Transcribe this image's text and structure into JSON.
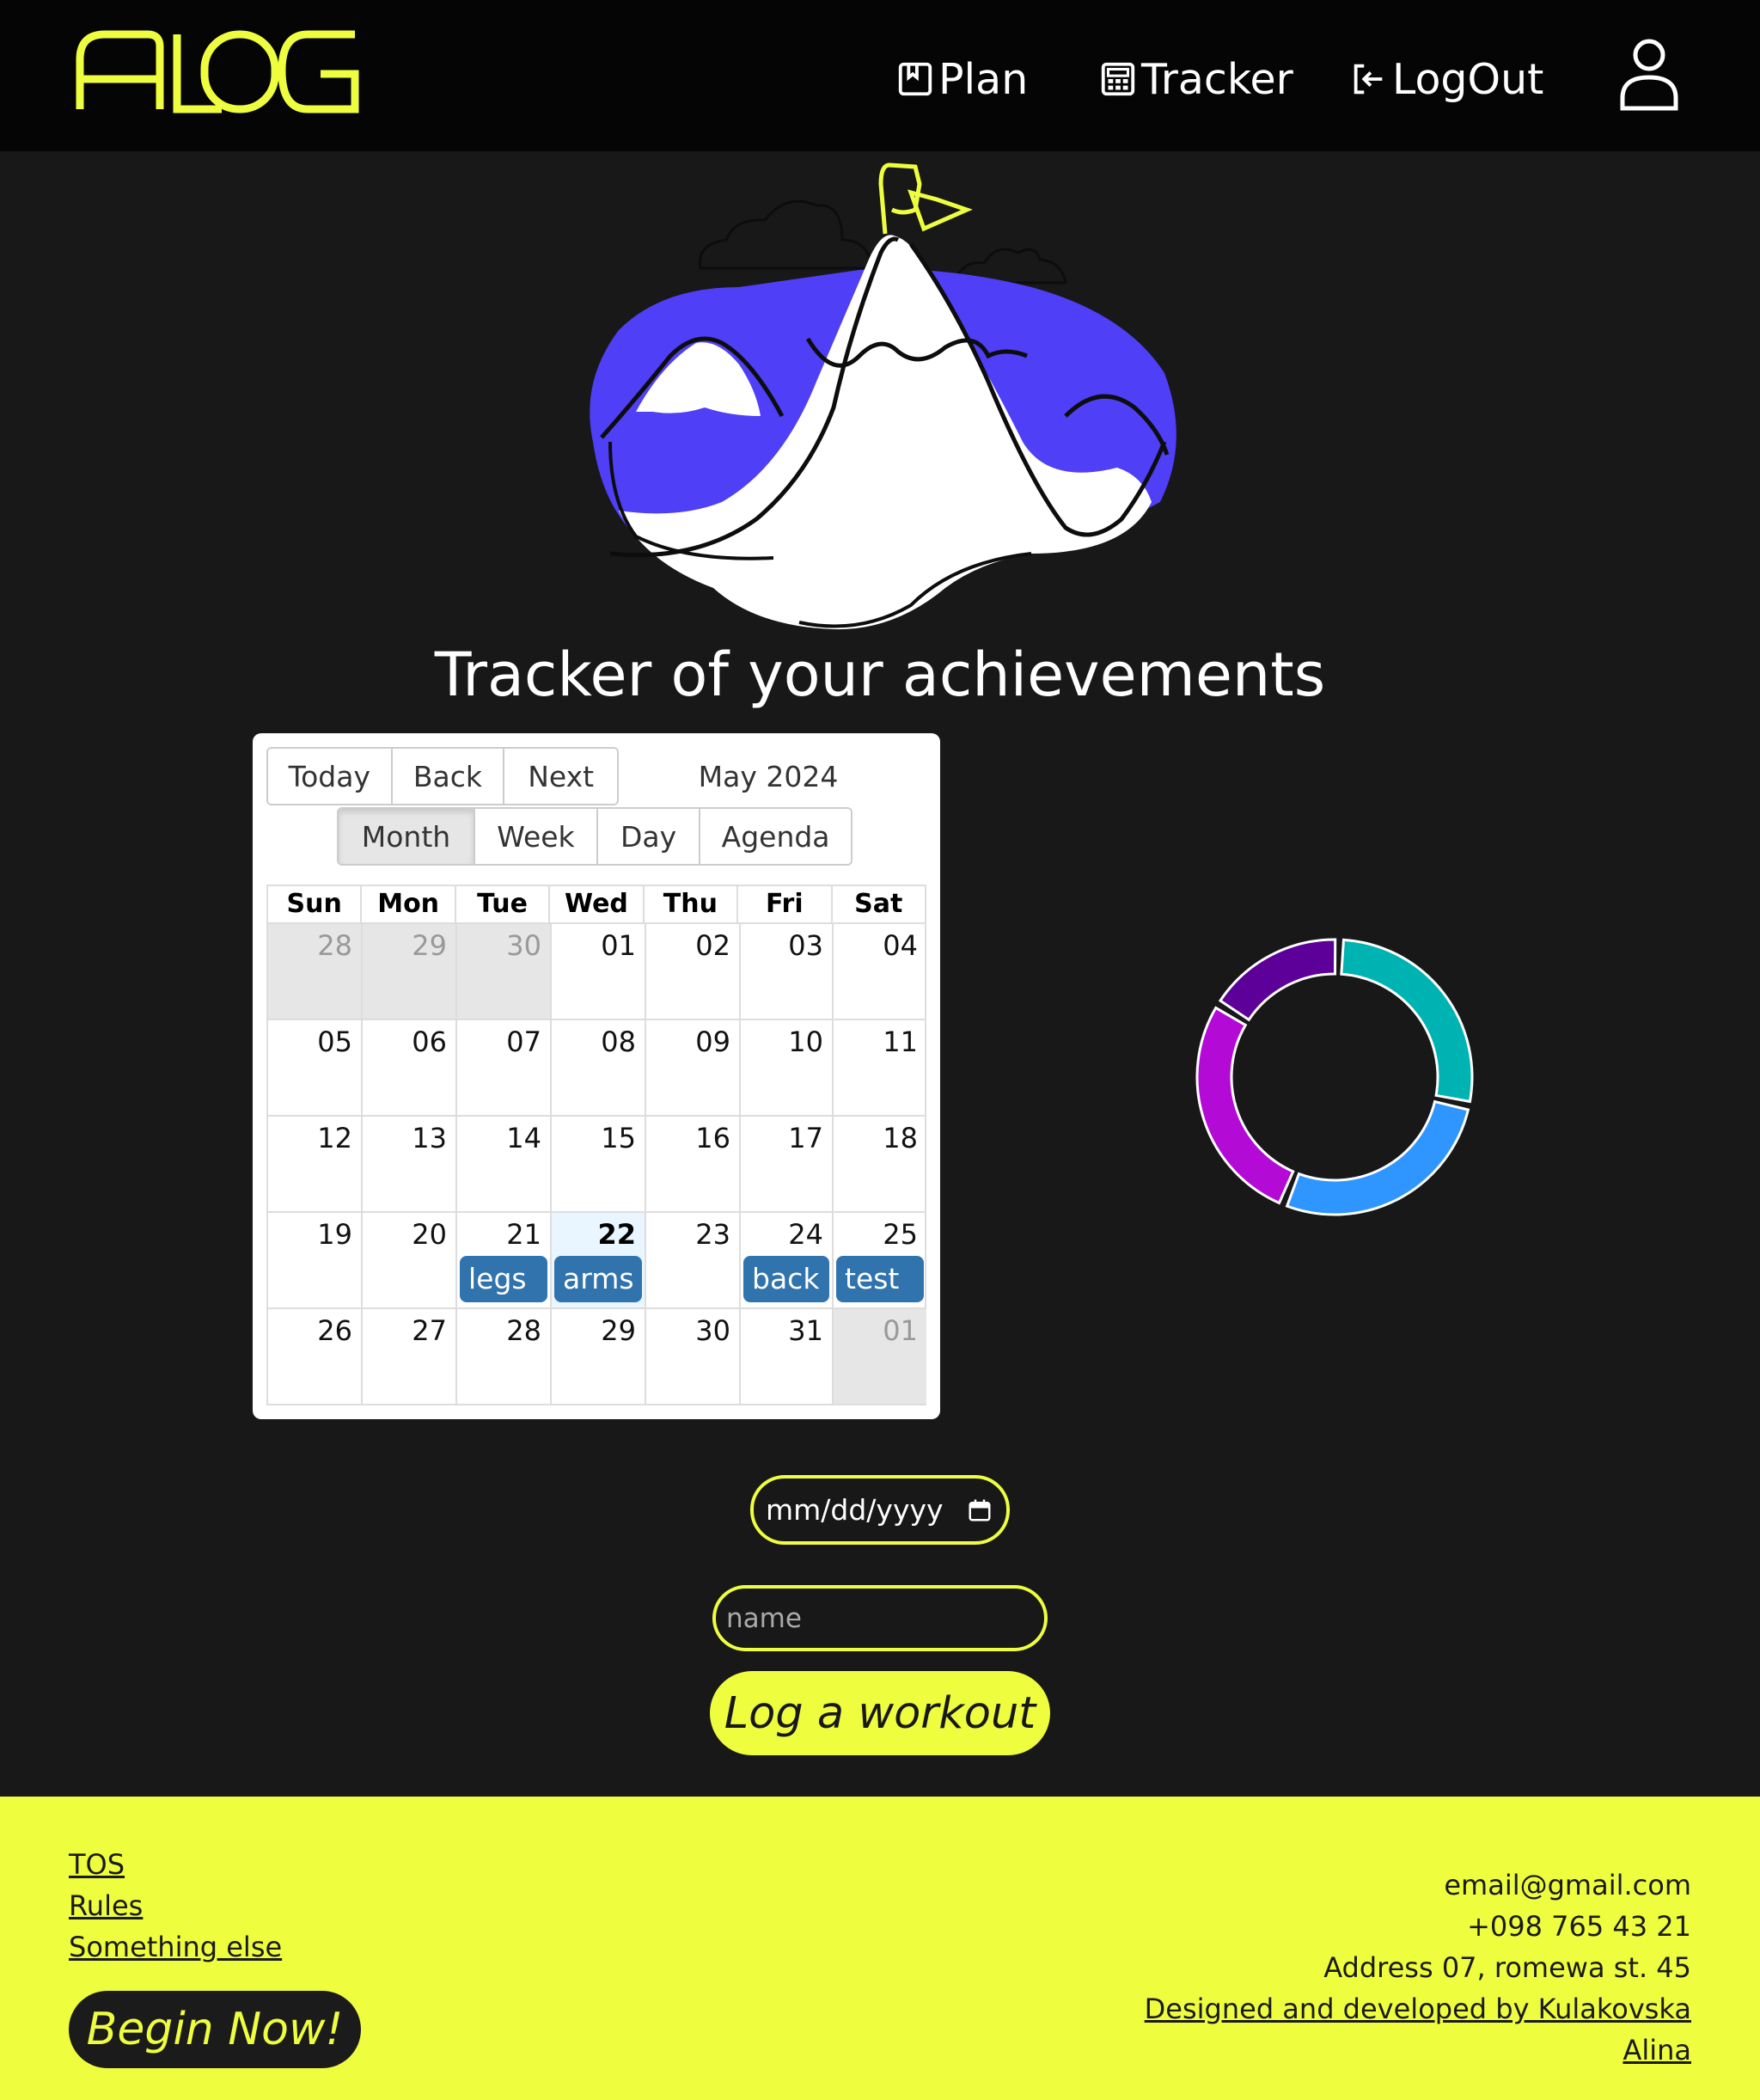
{
  "header": {
    "logo_text": "ALOG",
    "nav": [
      {
        "label": "Plan",
        "icon": "bookmark-icon"
      },
      {
        "label": "Tracker",
        "icon": "calculator-icon"
      },
      {
        "label": "LogOut",
        "icon": "logout-icon"
      }
    ],
    "avatar_icon": "user-icon"
  },
  "hero": {
    "title": "Tracker of your achievements",
    "illustration": "mountain-with-flag"
  },
  "calendar": {
    "nav_buttons": [
      "Today",
      "Back",
      "Next"
    ],
    "label": "May 2024",
    "view_buttons": [
      "Month",
      "Week",
      "Day",
      "Agenda"
    ],
    "active_view": "Month",
    "weekdays": [
      "Sun",
      "Mon",
      "Tue",
      "Wed",
      "Thu",
      "Fri",
      "Sat"
    ],
    "weeks": [
      [
        "28",
        "29",
        "30",
        "01",
        "02",
        "03",
        "04"
      ],
      [
        "05",
        "06",
        "07",
        "08",
        "09",
        "10",
        "11"
      ],
      [
        "12",
        "13",
        "14",
        "15",
        "16",
        "17",
        "18"
      ],
      [
        "19",
        "20",
        "21",
        "22",
        "23",
        "24",
        "25"
      ],
      [
        "26",
        "27",
        "28",
        "29",
        "30",
        "31",
        "01"
      ]
    ],
    "today": "22",
    "events": [
      {
        "date": "21",
        "title": "legs"
      },
      {
        "date": "22",
        "title": "arms"
      },
      {
        "date": "24",
        "title": "back"
      },
      {
        "date": "25",
        "title": "test"
      }
    ],
    "event_color": "#3174ad"
  },
  "donut": {
    "segments": [
      {
        "color": "#00b3b3",
        "value": 1
      },
      {
        "color": "#2f96ff",
        "value": 1
      },
      {
        "color": "#b30ad6",
        "value": 1
      },
      {
        "color": "#5c0099",
        "value": 0.6
      }
    ]
  },
  "form": {
    "date_placeholder": "mm/dd/yyyy",
    "name_placeholder": "name",
    "submit_label": "Log a workout"
  },
  "footer": {
    "links": [
      "TOS",
      "Rules",
      "Something else"
    ],
    "cta_label": "Begin Now!",
    "email": "email@gmail.com",
    "phone": "+098 765 43 21",
    "address": "Address 07, romewa st. 45",
    "credit_line1": "Designed and developed by Kulakovska",
    "credit_line2": "Alina"
  },
  "colors": {
    "accent": "#eefe3f",
    "background": "#181818",
    "header_bg": "#050505",
    "illustration_blue": "#4f3ff7"
  }
}
